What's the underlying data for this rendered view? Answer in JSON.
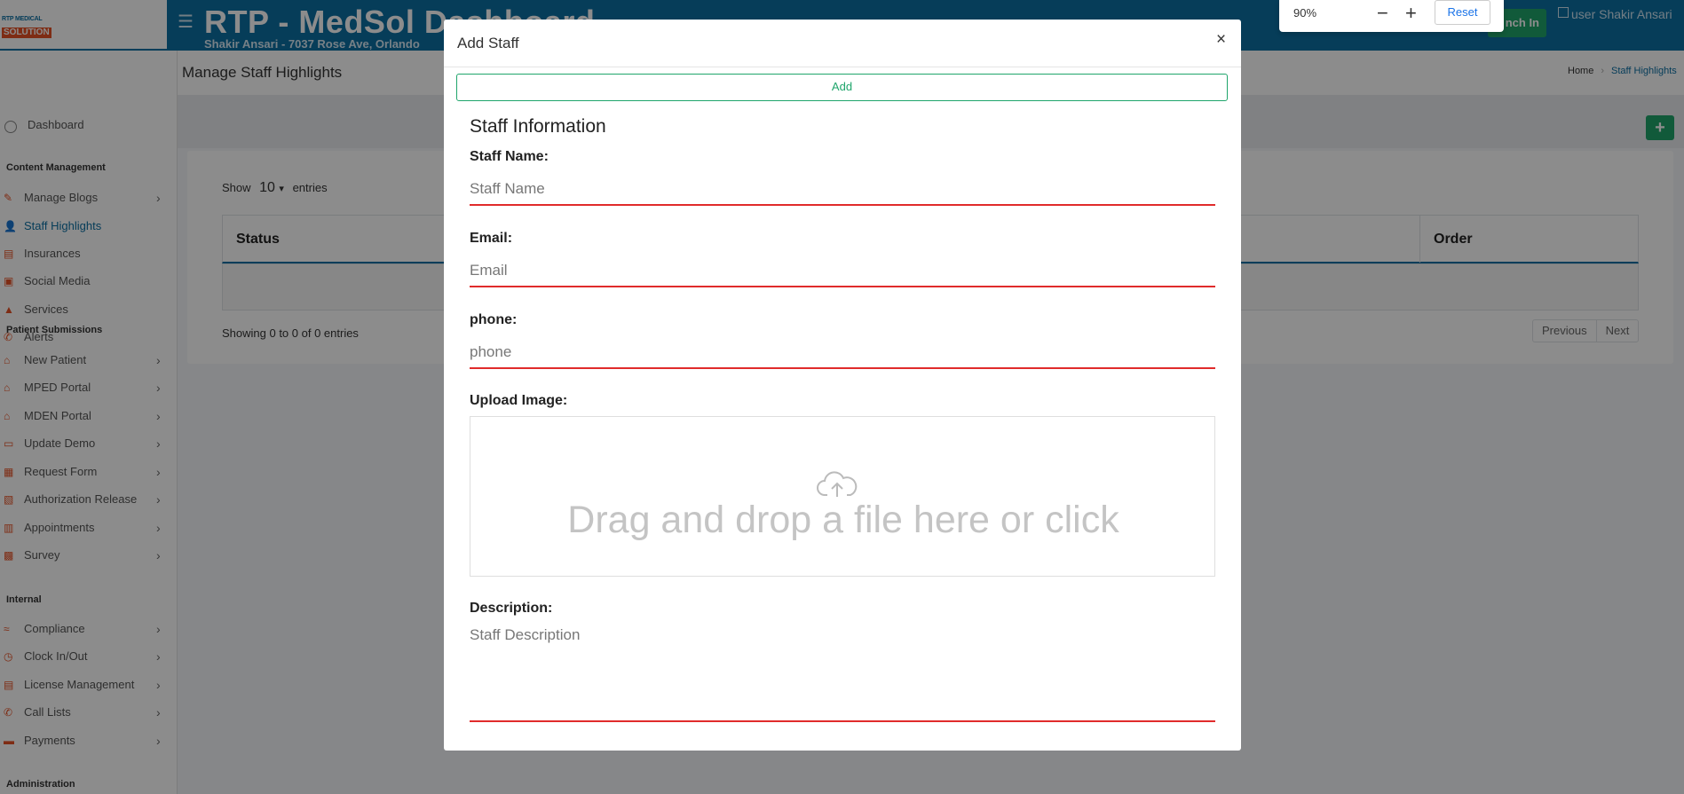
{
  "header": {
    "logo_line1": "RTP MEDICAL",
    "logo_line2": "SOLUTION",
    "title": "RTP - MedSol Dashboard",
    "subtitle": "Shakir Ansari - 7037 Rose Ave, Orlando",
    "punch_label": "nch In",
    "user_alt": "user",
    "user_name": "Shakir Ansari"
  },
  "zoom": {
    "value": "90%",
    "minus": "−",
    "plus": "+",
    "reset_label": "Reset"
  },
  "sidebar": {
    "dashboard": "Dashboard",
    "sections": {
      "content": "Content Management",
      "patient": "Patient Submissions",
      "internal": "Internal",
      "admin": "Administration"
    },
    "content_items": [
      {
        "label": "Manage Blogs",
        "icon": "blog-icon",
        "chev": true
      },
      {
        "label": "Staff Highlights",
        "icon": "staff-icon",
        "chev": false,
        "active": true
      },
      {
        "label": "Insurances",
        "icon": "insurance-icon",
        "chev": false
      },
      {
        "label": "Social Media",
        "icon": "social-media-icon",
        "chev": false
      },
      {
        "label": "Services",
        "icon": "services-icon",
        "chev": false
      },
      {
        "label": "Alerts",
        "icon": "alerts-icon",
        "chev": false
      }
    ],
    "patient_items": [
      {
        "label": "New Patient",
        "icon": "home-icon"
      },
      {
        "label": "MPED Portal",
        "icon": "home-icon"
      },
      {
        "label": "MDEN Portal",
        "icon": "home-icon"
      },
      {
        "label": "Update Demo",
        "icon": "id-card-icon"
      },
      {
        "label": "Request Form",
        "icon": "form-icon"
      },
      {
        "label": "Authorization Release",
        "icon": "clipboard-icon"
      },
      {
        "label": "Appointments",
        "icon": "calendar-icon"
      },
      {
        "label": "Survey",
        "icon": "survey-icon"
      }
    ],
    "internal_items": [
      {
        "label": "Compliance",
        "icon": "compliance-icon"
      },
      {
        "label": "Clock In/Out",
        "icon": "clock-icon"
      },
      {
        "label": "License Management",
        "icon": "license-icon"
      },
      {
        "label": "Call Lists",
        "icon": "phone-icon"
      },
      {
        "label": "Payments",
        "icon": "payments-icon"
      }
    ],
    "chevron": "›"
  },
  "main": {
    "page_title": "Manage Staff Highlights",
    "breadcrumb_home": "Home",
    "breadcrumb_sep": "›",
    "breadcrumb_current": "Staff Highlights",
    "fab_label": "+",
    "show_label": "Show",
    "entries_value": "10",
    "entries_label": "entries",
    "columns": [
      "Status",
      "Order"
    ],
    "showing_text": "Showing 0 to 0 of 0 entries",
    "prev_label": "Previous",
    "next_label": "Next"
  },
  "modal": {
    "title": "Add Staff",
    "close_glyph": "×",
    "add_label": "Add",
    "section_title": "Staff Information",
    "staff_name_label": "Staff Name:",
    "staff_name_placeholder": "Staff Name",
    "email_label": "Email:",
    "email_placeholder": "Email",
    "phone_label": "phone:",
    "phone_placeholder": "phone",
    "upload_label": "Upload Image:",
    "dropzone_text": "Drag and drop a file here or click",
    "description_label": "Description:",
    "description_placeholder": "Staff Description"
  },
  "colors": {
    "brand_blue": "#0c6fa3",
    "accent_orange": "#e65125",
    "success_green": "#1fa56b",
    "error_red": "#e02b2b"
  }
}
